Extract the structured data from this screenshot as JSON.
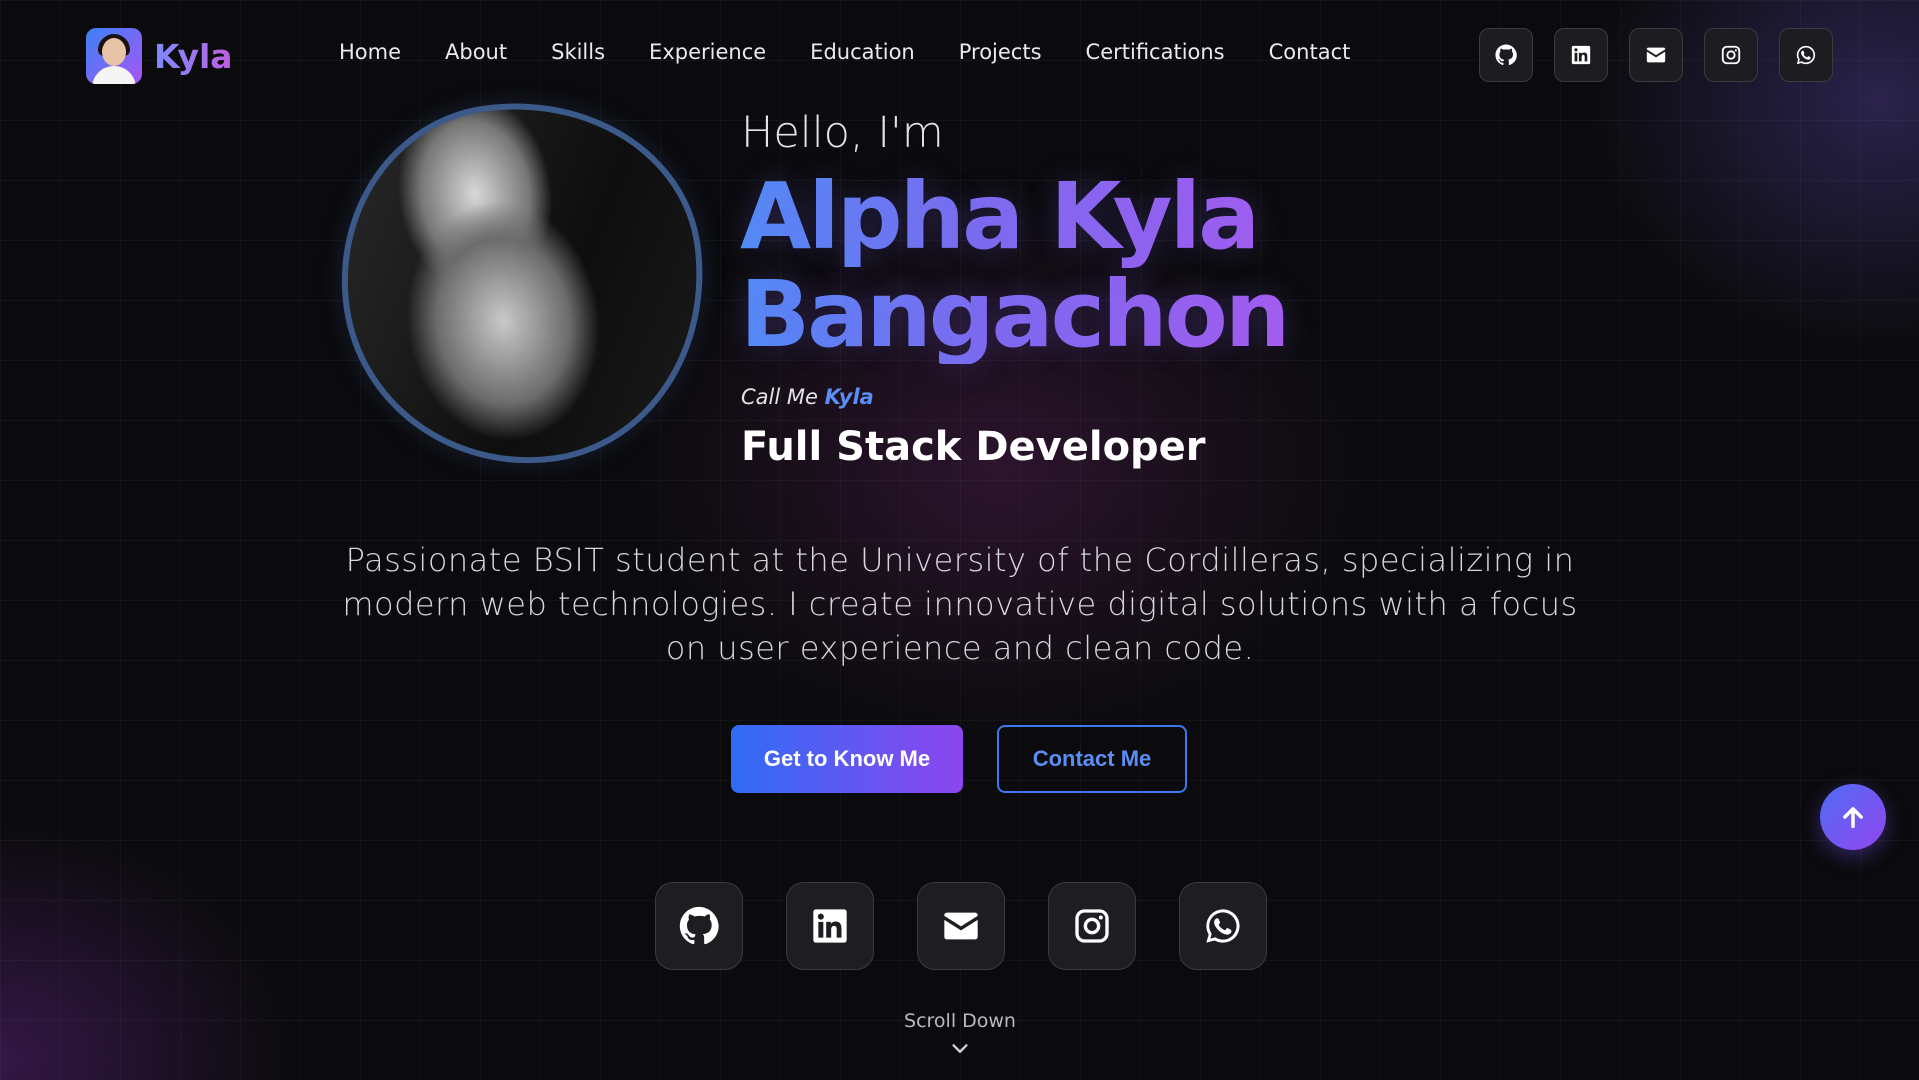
{
  "brand": {
    "name": "Kyla"
  },
  "nav": {
    "links": [
      "Home",
      "About",
      "Skills",
      "Experience",
      "Education",
      "Projects",
      "Certifications",
      "Contact"
    ]
  },
  "social_icons": [
    "github-icon",
    "linkedin-icon",
    "email-icon",
    "instagram-icon",
    "whatsapp-icon"
  ],
  "hero": {
    "greeting": "Hello, I'm",
    "name_line1": "Alpha Kyla",
    "name_line2": "Bangachon",
    "call_me_prefix": "Call Me",
    "nickname": "Kyla",
    "role": "Full Stack Developer",
    "description": "Passionate BSIT student at the University of the Cordilleras, specializing in modern web technologies. I create innovative digital solutions with a focus on user experience and clean code.",
    "primary_button": "Get to Know Me",
    "secondary_button": "Contact Me",
    "scroll_label": "Scroll Down"
  },
  "colors": {
    "background": "#0b0b0d",
    "accent_blue": "#3b82f6",
    "accent_purple": "#a855f7",
    "photo_border": "#3b5a8a"
  }
}
